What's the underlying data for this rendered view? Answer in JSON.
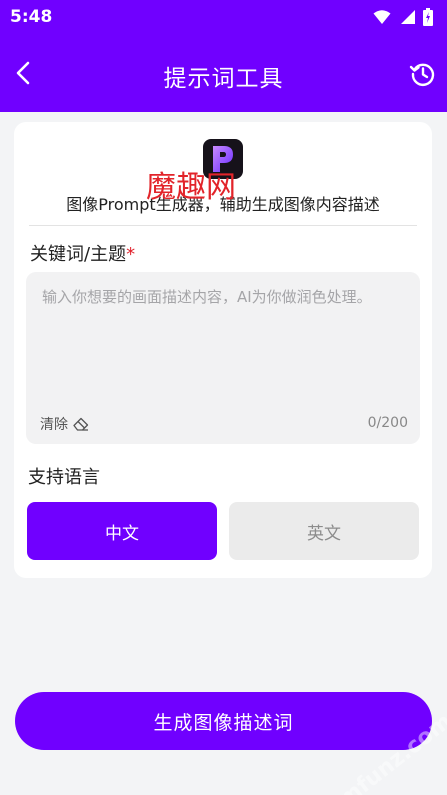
{
  "status_bar": {
    "time": "5:48"
  },
  "header": {
    "title": "提示词工具"
  },
  "tool": {
    "logo_letter": "P",
    "description": "图像Prompt生成器，辅助生成图像内容描述"
  },
  "keyword": {
    "label": "关键词/主题",
    "required_mark": "*",
    "value": "",
    "placeholder": "输入你想要的画面描述内容，AI为你做润色处理。",
    "clear_label": "清除",
    "counter": "0/200"
  },
  "language": {
    "label": "支持语言",
    "options": [
      "中文",
      "英文"
    ],
    "selected": "中文"
  },
  "actions": {
    "generate_label": "生成图像描述词"
  },
  "watermarks": {
    "center": "魔趣网",
    "corner": "mfunz.com 魔趣网"
  },
  "colors": {
    "primary": "#7000ff",
    "background": "#f3f4f6",
    "required": "#e0202a"
  },
  "icons": {
    "back": "arrow-left-icon",
    "history": "history-icon",
    "clear": "eraser-icon",
    "wifi": "wifi-icon",
    "signal": "signal-icon",
    "battery": "battery-icon"
  }
}
